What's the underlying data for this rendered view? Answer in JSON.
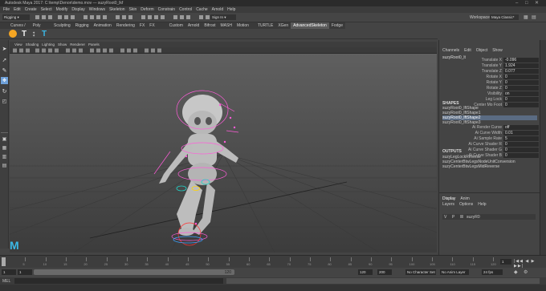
{
  "window": {
    "title": "Autodesk Maya 2017: C:\\temp\\Denon\\demo.mov  —  suzyRoot0_lkf"
  },
  "menus": [
    "File",
    "Edit",
    "Create",
    "Select",
    "Modify",
    "Display",
    "Windows",
    "Skeleton",
    "Skin",
    "Deform",
    "Constrain",
    "Control",
    "Cache",
    "Arnold",
    "Help"
  ],
  "status": {
    "mode": "Rigging",
    "workspace_label": "Workspace:",
    "workspace_value": "Maya Classic*",
    "signin": "Sign In"
  },
  "shelf_tabs": [
    "Curves / Surfaces",
    "Poly Modeling",
    "Sculpting",
    "Rigging",
    "Animation",
    "Rendering",
    "FX",
    "FX Caching",
    "Custom",
    "Arnold",
    "Bifrost",
    "MASH",
    "Motion Graphics",
    "TURTLE",
    "XGen",
    "AdvancedSkeleton",
    "Fodge"
  ],
  "shelf_active": "AdvancedSkeleton",
  "viewport_menu": [
    "View",
    "Shading",
    "Lighting",
    "Show",
    "Renderer",
    "Panels"
  ],
  "channel_box": {
    "menu": [
      "Channels",
      "Edit",
      "Object",
      "Show"
    ],
    "object": "suzyRoot0_lt",
    "attrs": [
      {
        "k": "Translate X",
        "v": "-0.096"
      },
      {
        "k": "Translate Y",
        "v": "1.924"
      },
      {
        "k": "Translate Z",
        "v": "0.077"
      },
      {
        "k": "Rotate X",
        "v": "0"
      },
      {
        "k": "Rotate Y",
        "v": "0"
      },
      {
        "k": "Rotate Z",
        "v": "0"
      },
      {
        "k": "Visibility",
        "v": "on"
      },
      {
        "k": "Leg Lock",
        "v": "0"
      },
      {
        "k": "Center Mo Foot",
        "v": "0"
      }
    ],
    "shapes_label": "SHAPES",
    "shapes": [
      "suzyRoot0_lftShape",
      "suzyRoot0_lftShape1",
      "suzyRoot0_lftShape2",
      "suzyRoot0_lftShape3"
    ],
    "shape_attrs": [
      {
        "k": "Ai Render Curve",
        "v": "off"
      },
      {
        "k": "Ai Curve Width",
        "v": "0.01"
      },
      {
        "k": "Ai Sample Rate",
        "v": "5"
      },
      {
        "k": "Ai Curve Shader R",
        "v": "0"
      },
      {
        "k": "Ai Curve Shader G",
        "v": "0"
      },
      {
        "k": "Ai Curve Shader B",
        "v": "0"
      }
    ],
    "outputs_label": "OUTPUTS",
    "outputs": [
      "suzyLegLockReverse",
      "suzyCenterBtwLegsNodeUnitConversion",
      "suzyCenterBtwLegsMidReverse"
    ]
  },
  "layer_editor": {
    "tabs": [
      "Display",
      "Anim"
    ],
    "menu": [
      "Layers",
      "Options",
      "Help"
    ],
    "layer_v": "V",
    "layer_p": "P",
    "layer_name": "suzyR0"
  },
  "timeline": {
    "ticks": [
      "5",
      "10",
      "15",
      "20",
      "25",
      "30",
      "35",
      "40",
      "45",
      "50",
      "55",
      "60",
      "65",
      "70",
      "75",
      "80",
      "85",
      "90",
      "95",
      "100",
      "105",
      "110",
      "115",
      "120"
    ],
    "current": "1"
  },
  "range": {
    "start": "1",
    "inner_start": "1",
    "range_label": "120",
    "inner_end": "120",
    "end": "200",
    "character_set": "No Character Set",
    "anim_layer": "No Anim Layer",
    "fps": "24 fps"
  },
  "cmd": {
    "label": "MEL"
  },
  "accent": "#ff5cd9"
}
